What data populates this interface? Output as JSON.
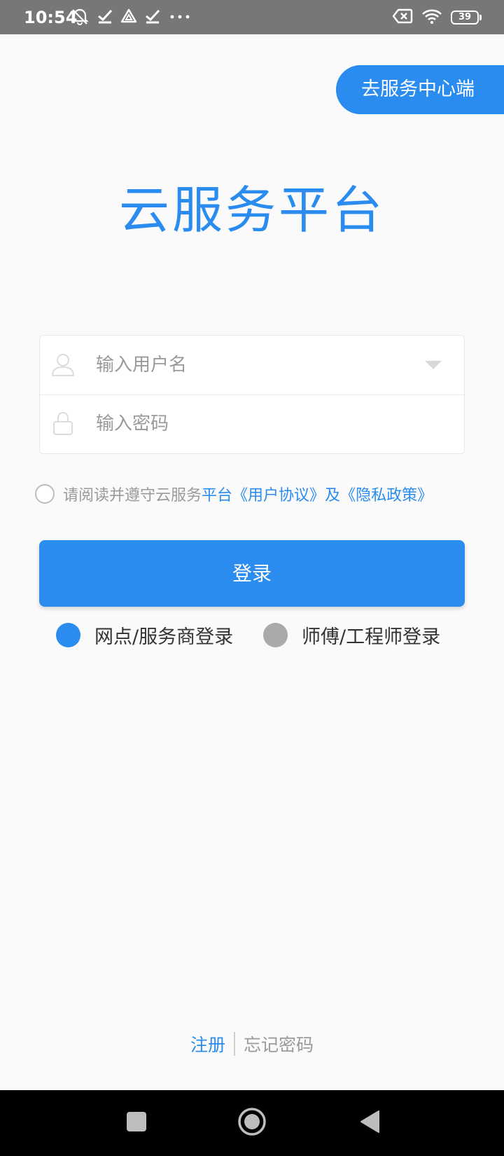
{
  "status_bar": {
    "time": "10:54",
    "icons_left": [
      "mute-icon",
      "check-icon",
      "drive-icon",
      "check-icon",
      "more-dots-icon"
    ],
    "icons_right": [
      "no-sim-icon",
      "wifi-icon",
      "battery-icon"
    ],
    "battery_level": "39"
  },
  "header": {
    "service_center_button": "去服务中心端"
  },
  "title": "云服务平台",
  "form": {
    "username_placeholder": "输入用户名",
    "password_placeholder": "输入密码"
  },
  "agreement": {
    "checked": false,
    "prefix": "请阅读并遵守云服务",
    "platform": "平台",
    "user_agreement": "《用户协议》",
    "and": "及",
    "privacy_policy": "《隐私政策》"
  },
  "login_button": "登录",
  "roles": [
    {
      "label": "网点/服务商登录",
      "selected": true
    },
    {
      "label": "师傅/工程师登录",
      "selected": false
    }
  ],
  "footer": {
    "register": "注册",
    "forgot_password": "忘记密码"
  },
  "nav_bar": {
    "buttons": [
      "recents-icon",
      "home-icon",
      "back-icon"
    ]
  },
  "colors": {
    "accent": "#2a8cef",
    "status_bar": "#777777",
    "background": "#fafafa",
    "role_unselected": "#aaaaaa"
  }
}
